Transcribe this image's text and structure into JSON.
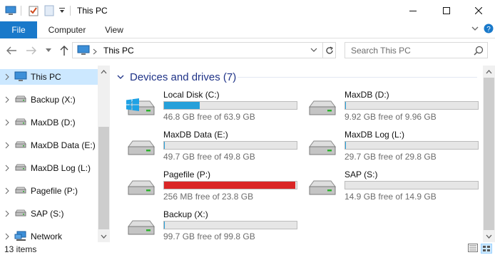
{
  "window": {
    "title": "This PC"
  },
  "ribbon": {
    "tabs": [
      "File",
      "Computer",
      "View"
    ]
  },
  "address": {
    "path": "This PC",
    "search_placeholder": "Search This PC"
  },
  "nav": {
    "items": [
      {
        "label": "This PC",
        "icon": "computer-icon",
        "selected": true
      },
      {
        "label": "Backup (X:)",
        "icon": "drive-icon"
      },
      {
        "label": "MaxDB (D:)",
        "icon": "drive-icon"
      },
      {
        "label": "MaxDB Data (E:)",
        "icon": "drive-icon"
      },
      {
        "label": "MaxDB Log (L:)",
        "icon": "drive-icon"
      },
      {
        "label": "Pagefile (P:)",
        "icon": "drive-icon"
      },
      {
        "label": "SAP (S:)",
        "icon": "drive-icon"
      },
      {
        "label": "Network",
        "icon": "network-icon"
      }
    ]
  },
  "content": {
    "group_title": "Devices and drives (7)",
    "drives": [
      {
        "name": "Local Disk (C:)",
        "free": "46.8 GB free of 63.9 GB",
        "used_fraction": 0.268,
        "bar_color": "#26a0da",
        "windows": true
      },
      {
        "name": "MaxDB (D:)",
        "free": "9.92 GB free of 9.96 GB",
        "used_fraction": 0.004,
        "bar_color": "#26a0da"
      },
      {
        "name": "MaxDB Data (E:)",
        "free": "49.7 GB free of 49.8 GB",
        "used_fraction": 0.002,
        "bar_color": "#26a0da"
      },
      {
        "name": "MaxDB Log (L:)",
        "free": "29.7 GB free of 29.8 GB",
        "used_fraction": 0.003,
        "bar_color": "#26a0da"
      },
      {
        "name": "Pagefile (P:)",
        "free": "256 MB free of 23.8 GB",
        "used_fraction": 0.99,
        "bar_color": "#da2626"
      },
      {
        "name": "SAP (S:)",
        "free": "14.9 GB free of 14.9 GB",
        "used_fraction": 0.0,
        "bar_color": "#26a0da"
      },
      {
        "name": "Backup (X:)",
        "free": "99.7 GB free of 99.8 GB",
        "used_fraction": 0.001,
        "bar_color": "#26a0da"
      }
    ]
  },
  "status": {
    "item_count": "13 items"
  },
  "colors": {
    "accent": "#1979ca",
    "selection": "#cce8ff",
    "bar_normal": "#26a0da",
    "bar_full": "#da2626"
  }
}
